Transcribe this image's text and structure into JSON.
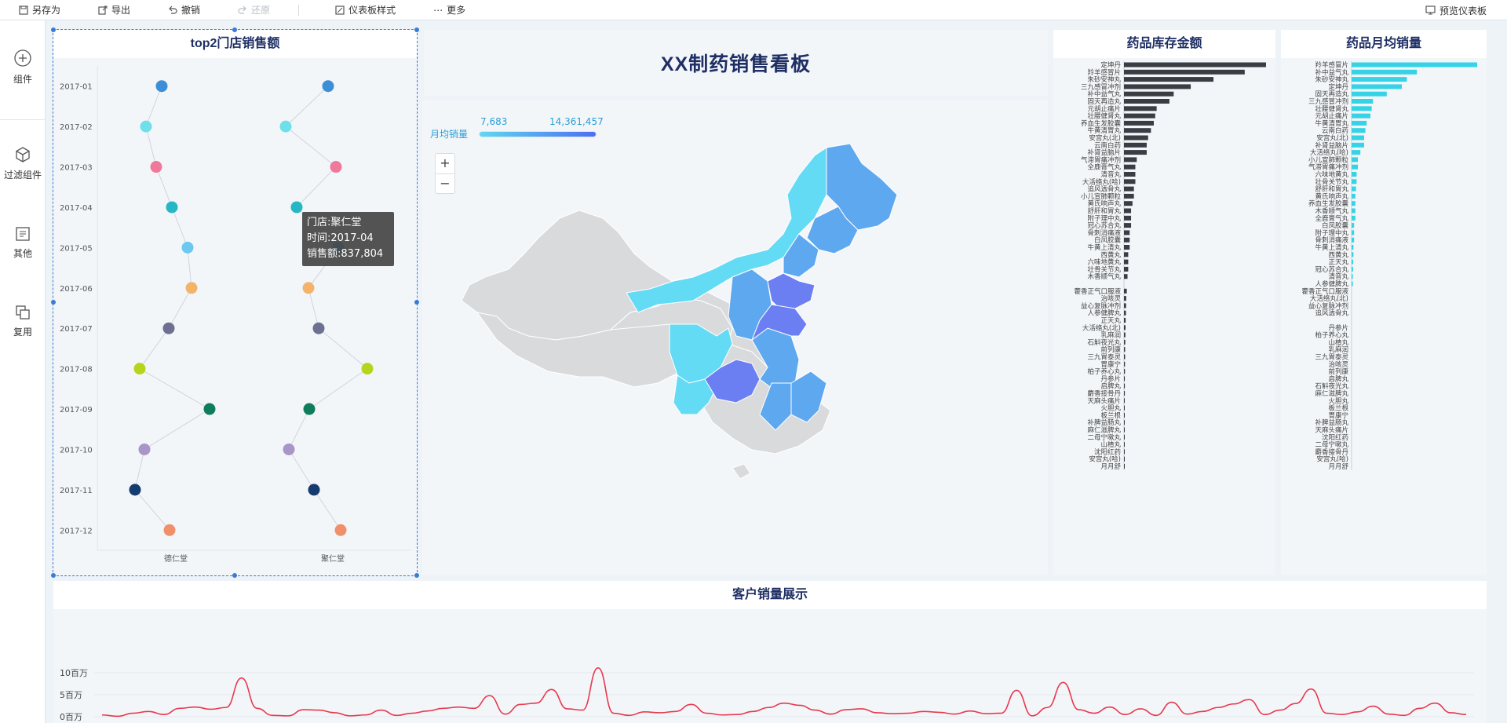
{
  "toolbar": {
    "save_as": "另存为",
    "export": "导出",
    "undo": "撤销",
    "redo": "还原",
    "dashboard_style": "仪表板样式",
    "more": "更多",
    "preview": "预览仪表板"
  },
  "rail": {
    "components": "组件",
    "filter_components": "过滤组件",
    "other": "其他",
    "reuse": "复用"
  },
  "dashboard_title": "XX制药销售看板",
  "store_panel": {
    "title": "top2门店销售额",
    "tooltip": {
      "store": "门店:聚仁堂",
      "time": "时间:2017-04",
      "sales": "销售额:837,804"
    }
  },
  "map_panel": {
    "legend_label": "月均销量",
    "legend_min": "7,683",
    "legend_max": "14,361,457",
    "zoom_in": "+",
    "zoom_out": "−"
  },
  "inventory_panel": {
    "title": "药品库存金额"
  },
  "monthly_panel": {
    "title": "药品月均销量"
  },
  "customer_panel": {
    "title": "客户销量展示"
  },
  "colors": {
    "accent": "#3a7bd5",
    "title": "#1f2f64",
    "bar_dark": "#3a3d44",
    "bar_cyan": "#36d3e6",
    "line_red": "#e8384f"
  },
  "chart_data": [
    {
      "type": "scatter",
      "title": "top2门店销售额",
      "categories": [
        "2017-01",
        "2017-02",
        "2017-03",
        "2017-04",
        "2017-05",
        "2017-06",
        "2017-07",
        "2017-08",
        "2017-09",
        "2017-10",
        "2017-11",
        "2017-12"
      ],
      "x_categories": [
        "德仁堂",
        "聚仁堂"
      ],
      "point_colors": [
        "#3c8fd6",
        "#6ee0ea",
        "#f0789a",
        "#27b6c3",
        "#6cc8ee",
        "#f4b36b",
        "#6d7090",
        "#b6d41c",
        "#0e7d5a",
        "#a996c8",
        "#163b6e",
        "#f0906b"
      ],
      "series": [
        {
          "name": "德仁堂",
          "offsets": [
            -0.18,
            -0.38,
            -0.25,
            -0.05,
            0.15,
            0.2,
            -0.09,
            -0.46,
            0.43,
            -0.4,
            -0.52,
            -0.08
          ]
        },
        {
          "name": "聚仁堂",
          "offsets": [
            -0.06,
            -0.6,
            0.04,
            -0.46,
            0.07,
            -0.31,
            -0.18,
            0.44,
            -0.3,
            -0.56,
            -0.24,
            0.1
          ]
        }
      ]
    },
    {
      "type": "map",
      "title": "",
      "legend": {
        "label": "月均销量",
        "min": "7,683",
        "max": "14,361,457"
      }
    },
    {
      "type": "bar",
      "title": "药品库存金额",
      "categories": [
        "定坤丹",
        "羚羊感冒片",
        "朱砂安神丸",
        "三九感冒冲剂",
        "补中益气丸",
        "固天再造丸",
        "元胡止痛片",
        "壮腰健肾丸",
        "养血生发胶囊",
        "牛黄清胃丸",
        "安宫丸(北)",
        "云南白药",
        "补肾益脑片",
        "气滞胃痛冲剂",
        "全鹿膏气丸",
        "清音丸",
        "大活络丸(哈)",
        "追风透骨丸",
        "小儿宣肺颗粒",
        "黄氏响声丸",
        "舒肝和胃丸",
        "附子理中丸",
        "冠心苏合丸",
        "骨刺消痛液",
        "白凤胶囊",
        "牛黄上清丸",
        "西黄丸",
        "六味地黄丸",
        "壮骨关节丸",
        "木香顺气丸",
        "",
        "藿香正气口服液",
        "治咳灵",
        "益心复脉冲剂",
        "人参健脾丸",
        "正天丸",
        "大活络丸(北)",
        "乳麻润",
        "石斛夜光丸",
        "前列康",
        "三九胃泰灵",
        "胃康宁",
        "柏子养心丸",
        "丹参片",
        "启脾丸",
        "麝香接骨丹",
        "天麻头痛片",
        "火胆丸",
        "板兰根",
        "补脾益肠丸",
        "麻仁滋脾丸",
        "二母宁嗽丸",
        "山楂丸",
        "沈阳红药",
        "安宫丸(哈)",
        "月月舒"
      ],
      "values": [
        100,
        85,
        63,
        47,
        35,
        32,
        23,
        22,
        21,
        19,
        17,
        16,
        16,
        9,
        8,
        8,
        8,
        7,
        7,
        6,
        5,
        5,
        5,
        4,
        4,
        4,
        3,
        3,
        3,
        2.5,
        0,
        2,
        1.6,
        1.5,
        1.4,
        1.2,
        1.1,
        1,
        0.9,
        0.8,
        0.8,
        0.7,
        0.7,
        0.6,
        0.6,
        0.6,
        0.5,
        0.5,
        0.5,
        0.4,
        0.4,
        0.4,
        0.3,
        0.3,
        0.3,
        0.3
      ]
    },
    {
      "type": "bar",
      "title": "药品月均销量",
      "categories": [
        "羚羊感冒片",
        "补中益气丸",
        "朱砂安神丸",
        "定坤丹",
        "固天再造丸",
        "三九感冒冲剂",
        "壮腰健肾丸",
        "元胡止痛片",
        "牛黄清胃丸",
        "云南白药",
        "安宫丸(北)",
        "补肾益脑片",
        "大活络丸(哈)",
        "小儿宣肺颗粒",
        "气滞胃痛冲剂",
        "六味地黄丸",
        "壮骨关节丸",
        "舒肝和胃丸",
        "黄氏响声丸",
        "养血生发胶囊",
        "木香顺气丸",
        "全鹿膏气丸",
        "白凤胶囊",
        "附子理中丸",
        "骨刺消痛液",
        "牛黄上清丸",
        "西黄丸",
        "正天丸",
        "冠心苏合丸",
        "清音丸",
        "人参健脾丸",
        "藿香正气口服液",
        "大活络丸(北)",
        "益心复脉冲剂",
        "追风透骨丸",
        "",
        "丹参片",
        "柏子养心丸",
        "山楂丸",
        "乳麻润",
        "三九胃泰灵",
        "治咳灵",
        "前列康",
        "启脾丸",
        "石斛夜光丸",
        "麻仁滋脾丸",
        "火胆丸",
        "板兰根",
        "胃康宁",
        "补脾益肠丸",
        "天麻头痛片",
        "沈阳红药",
        "二母宁嗽丸",
        "麝香接骨丹",
        "安宫丸(哈)",
        "月月舒"
      ],
      "values": [
        100,
        52,
        44,
        40,
        28,
        17,
        16,
        15,
        12,
        11,
        10,
        10,
        7,
        5,
        5,
        4,
        4,
        3.5,
        3,
        3,
        3,
        3,
        2,
        2,
        2,
        1.5,
        1.5,
        1.2,
        1.2,
        1,
        1,
        0,
        0,
        0,
        0,
        0,
        0,
        0,
        0,
        0,
        0,
        0,
        0,
        0,
        0,
        0,
        0,
        0,
        0,
        0,
        0,
        0,
        0,
        0,
        0,
        0
      ]
    },
    {
      "type": "line",
      "title": "客户销量展示",
      "ylabel": "",
      "y_ticks": [
        "0百万",
        "5百万",
        "10百万"
      ],
      "ylim": [
        0,
        10
      ],
      "values": [
        0.4,
        0.1,
        0.8,
        1.2,
        0.5,
        1.9,
        2.2,
        1.7,
        2.1,
        8.8,
        1.9,
        0.3,
        0.2,
        1.6,
        1.5,
        0.9,
        0.2,
        0.4,
        1.5,
        0.3,
        0.8,
        1.3,
        1.9,
        2.2,
        1.9,
        4.8,
        0.6,
        2.8,
        3.1,
        6.2,
        1.8,
        1.5,
        11.1,
        0.8,
        0.3,
        1.1,
        0.9,
        1.2,
        2.8,
        0.8,
        0.4,
        0.5,
        1.2,
        2.1,
        3.1,
        2.6,
        1.5,
        0.6,
        1.6,
        1.8,
        0.9,
        0.7,
        0.8,
        1.2,
        1.0,
        0.6,
        1.3,
        0.7,
        0.8,
        6.0,
        0.2,
        2.1,
        7.8,
        1.6,
        0.8,
        2.2,
        0.5,
        1.8,
        0.3,
        3.3,
        0.6,
        1.2,
        2.1,
        2.9,
        3.9,
        0.5,
        1.5,
        3.0,
        6.3,
        0.8,
        0.5,
        1.1,
        2.4,
        0.6,
        0.3,
        1.9,
        3.1,
        0.9,
        0.5
      ]
    }
  ]
}
